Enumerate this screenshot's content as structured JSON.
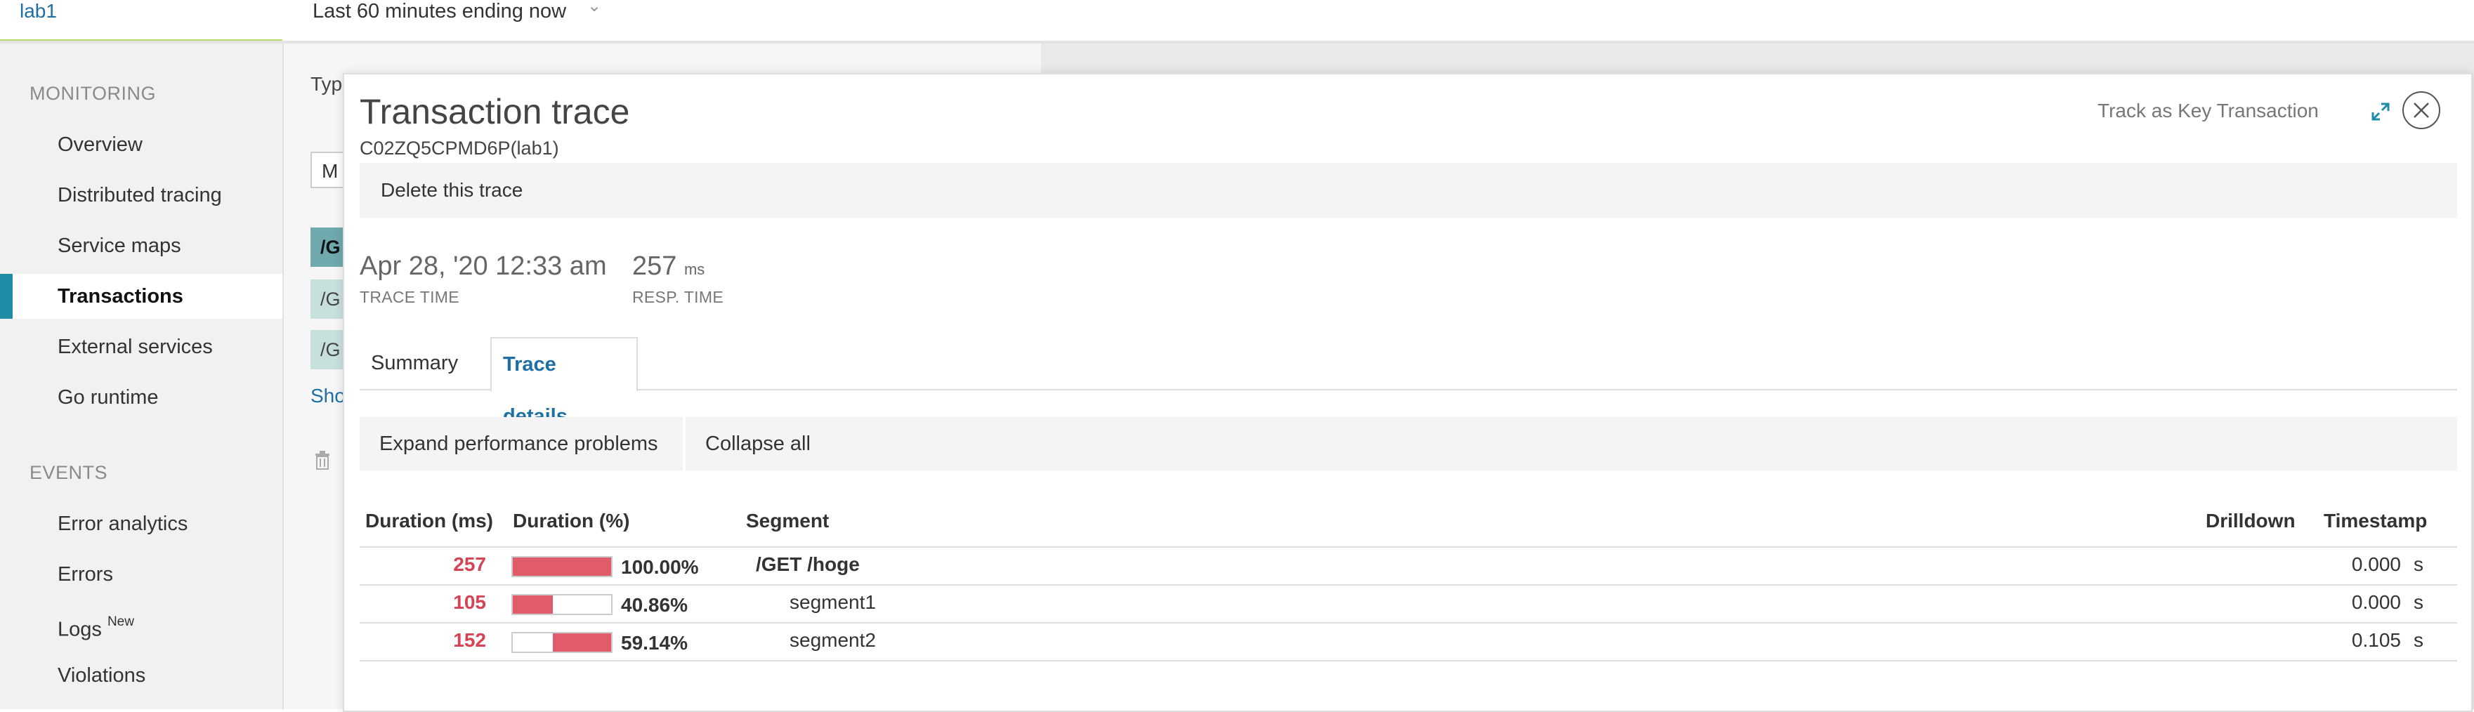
{
  "header": {
    "app_name": "lab1",
    "time_range": "Last 60 minutes ending now"
  },
  "sidebar": {
    "monitoring_heading": "MONITORING",
    "monitoring_items": [
      {
        "label": "Overview"
      },
      {
        "label": "Distributed tracing"
      },
      {
        "label": "Service maps"
      },
      {
        "label": "Transactions",
        "active": true
      },
      {
        "label": "External services"
      },
      {
        "label": "Go runtime"
      }
    ],
    "events_heading": "EVENTS",
    "events_items": [
      {
        "label": "Error analytics"
      },
      {
        "label": "Errors"
      },
      {
        "label": "Logs",
        "badge": "New"
      },
      {
        "label": "Violations"
      }
    ]
  },
  "underlying": {
    "type_label": "Typ",
    "select_value": "M",
    "rows": [
      "/G",
      "/G",
      "/G"
    ],
    "show_link": "Sho"
  },
  "modal": {
    "title": "Transaction trace",
    "subtitle": "C02ZQ5CPMD6P(lab1)",
    "track_key_label": "Track as Key Transaction",
    "delete_label": "Delete this trace",
    "trace_time": {
      "value": "Apr 28, '20 12:33 am",
      "label": "TRACE TIME"
    },
    "resp_time": {
      "value": "257",
      "unit": "ms",
      "label": "RESP. TIME"
    },
    "tabs": [
      {
        "label": "Summary",
        "active": false
      },
      {
        "label": "Trace details",
        "active": true
      }
    ],
    "actions": {
      "expand_label": "Expand performance problems",
      "collapse_label": "Collapse all"
    },
    "table": {
      "headers": {
        "duration_ms": "Duration (ms)",
        "duration_pct": "Duration (%)",
        "segment": "Segment",
        "drilldown": "Drilldown",
        "timestamp": "Timestamp"
      },
      "rows": [
        {
          "duration_ms": "257",
          "duration_pct": "100.00%",
          "bar_start": 0.0,
          "bar_fraction": 1.0,
          "segment": "/GET /hoge",
          "timestamp": "0.000",
          "ts_unit": "s"
        },
        {
          "duration_ms": "105",
          "duration_pct": "40.86%",
          "bar_start": 0.0,
          "bar_fraction": 0.4086,
          "segment": "segment1",
          "timestamp": "0.000",
          "ts_unit": "s"
        },
        {
          "duration_ms": "152",
          "duration_pct": "59.14%",
          "bar_start": 0.4086,
          "bar_fraction": 0.5914,
          "segment": "segment2",
          "timestamp": "0.105",
          "ts_unit": "s"
        }
      ]
    }
  },
  "colors": {
    "accent": "#1d6fa5",
    "active_marker": "#1d8ea5",
    "duration_red": "#d64355",
    "bar_fill": "#e05c6a"
  }
}
